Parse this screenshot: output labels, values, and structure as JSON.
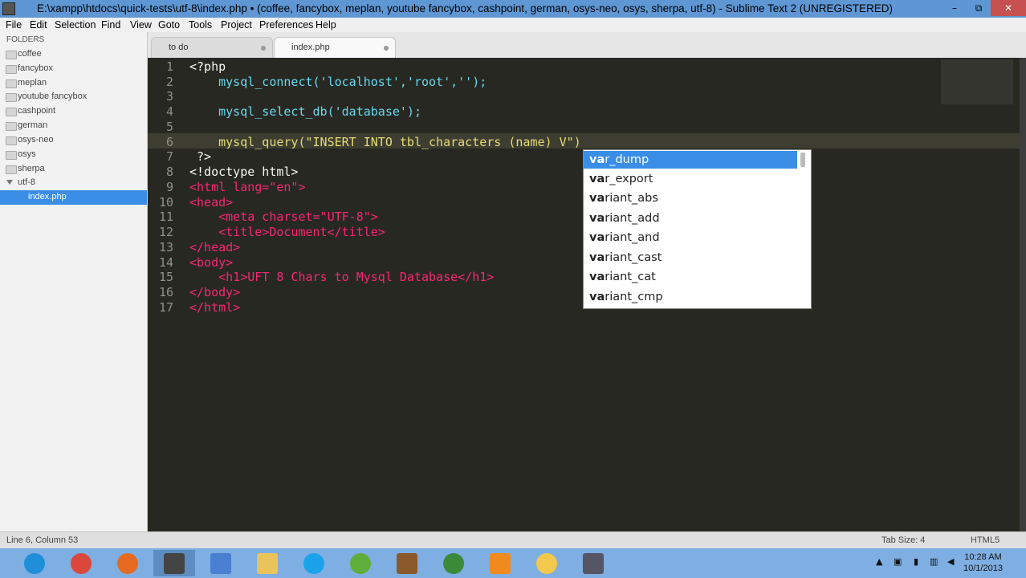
{
  "window": {
    "title": "E:\\xampp\\htdocs\\quick-tests\\utf-8\\index.php • (coffee, fancybox, meplan, youtube fancybox, cashpoint, german, osys-neo, osys, sherpa, utf-8) - Sublime Text 2 (UNREGISTERED)",
    "minimize": "–",
    "maximize": "⧉",
    "close": "✕"
  },
  "menu": [
    "File",
    "Edit",
    "Selection",
    "Find",
    "View",
    "Goto",
    "Tools",
    "Project",
    "Preferences",
    "Help"
  ],
  "sidebar": {
    "header": "FOLDERS",
    "items": [
      {
        "label": "coffee"
      },
      {
        "label": "fancybox"
      },
      {
        "label": "meplan"
      },
      {
        "label": "youtube fancybox"
      },
      {
        "label": "cashpoint"
      },
      {
        "label": "german"
      },
      {
        "label": "osys-neo"
      },
      {
        "label": "osys"
      },
      {
        "label": "sherpa"
      },
      {
        "label": "utf-8"
      },
      {
        "label": "index.php"
      }
    ]
  },
  "tabs": [
    {
      "label": "to do"
    },
    {
      "label": "index.php"
    }
  ],
  "editor": {
    "line_numbers": [
      "1",
      "2",
      "3",
      "4",
      "5",
      "6",
      "7",
      "8",
      "9",
      "10",
      "11",
      "12",
      "13",
      "14",
      "15",
      "16",
      "17"
    ],
    "lines": [
      "<?php",
      "    mysql_connect('localhost','root','');",
      "",
      "    mysql_select_db('database');",
      "",
      "    mysql_query(\"INSERT INTO tbl_characters (name) V\")",
      " ?>",
      "<!doctype html>",
      "<html lang=\"en\">",
      "<head>",
      "    <meta charset=\"UTF-8\">",
      "    <title>Document</title>",
      "</head>",
      "<body>",
      "    <h1>UFT 8 Chars to Mysql Database</h1>",
      "</body>",
      "</html>"
    ]
  },
  "autocomplete": {
    "items": [
      {
        "match": "va",
        "rest": "r_dump"
      },
      {
        "match": "va",
        "rest": "r_export"
      },
      {
        "match": "va",
        "rest": "riant_abs"
      },
      {
        "match": "va",
        "rest": "riant_add"
      },
      {
        "match": "va",
        "rest": "riant_and"
      },
      {
        "match": "va",
        "rest": "riant_cast"
      },
      {
        "match": "va",
        "rest": "riant_cat"
      },
      {
        "match": "va",
        "rest": "riant_cmp"
      }
    ],
    "selected_index": 0
  },
  "status": {
    "position": "Line 6, Column 53",
    "tab_size": "Tab Size: 4",
    "syntax": "HTML5"
  },
  "taskbar": {
    "apps": [
      "internet-explorer-icon",
      "chrome-icon",
      "firefox-icon",
      "sublime-text-icon",
      "paint-icon",
      "file-explorer-icon",
      "skype-icon",
      "media-player-icon",
      "film-icon",
      "network-globe-icon",
      "vlc-icon",
      "chat-icon",
      "game-icon"
    ],
    "time": "10:28 AM",
    "date": "10/1/2013"
  },
  "colors": {
    "editor_bg": "#272822",
    "selection_blue": "#3a8ee6",
    "keyword": "#66d9ef",
    "tag": "#f92672",
    "string": "#e6db74"
  }
}
